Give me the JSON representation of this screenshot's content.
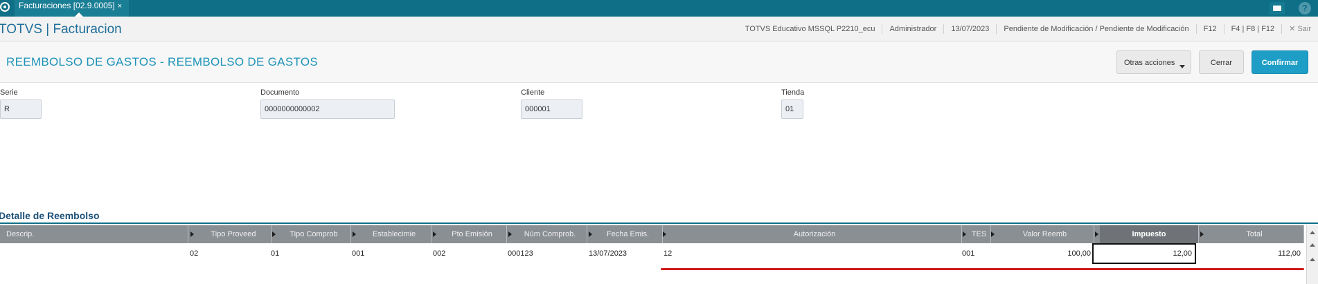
{
  "topbar": {
    "tab_label": "Facturaciones [02.9.0005]",
    "tab_close": "×",
    "help_glyph": "?"
  },
  "header": {
    "product": "TOTVS | Facturacion",
    "environment": "TOTVS Educativo MSSQL P2210_ecu",
    "user": "Administrador",
    "date": "13/07/2023",
    "status": "Pendiente de Modificación / Pendiente de Modificación",
    "key1": "F12",
    "key2": "F4 | F8 | F12",
    "exit": "✕  Sair"
  },
  "titlebar": {
    "title": "REEMBOLSO DE GASTOS - REEMBOLSO DE GASTOS",
    "otras_label": "Otras acciones",
    "cerrar_label": "Cerrar",
    "confirmar_label": "Confirmar"
  },
  "form": {
    "serie": {
      "label": "Serie",
      "value": "R"
    },
    "documento": {
      "label": "Documento",
      "value": "0000000000002"
    },
    "cliente": {
      "label": "Cliente",
      "value": "000001"
    },
    "tienda": {
      "label": "Tienda",
      "value": "01"
    }
  },
  "section": {
    "title": "Detalle de Reembolso"
  },
  "grid": {
    "headers": {
      "descrip": "Descrip.",
      "tipo_proveed": "Tipo Proveed",
      "tipo_comprob": "Tipo Comprob",
      "establecimie": "Establecimie",
      "pto_emision": "Pto Emisión",
      "num_comprob": "Núm Comprob.",
      "fecha_emis": "Fecha Emis.",
      "autorizacion": "Autorización",
      "tes": "TES",
      "valor_reemb": "Valor Reemb",
      "impuesto": "Impuesto",
      "total": "Total"
    },
    "row": {
      "descrip": "",
      "tipo_proveed": "02",
      "tipo_comprob": "01",
      "establecimie": "001",
      "pto_emision": "002",
      "num_comprob": "000123",
      "fecha_emis": "13/07/2023",
      "autorizacion": "12",
      "tes": "001",
      "valor_reemb": "100,00",
      "impuesto": "12,00",
      "total": "112,00"
    }
  },
  "colors": {
    "topbar": "#0e6f86",
    "accent": "#1e9ec6",
    "title": "#1c93b8",
    "grid_header": "#8a8f94",
    "highlight": "#d11a1a"
  },
  "icons": {
    "app": "totvs-logo-icon",
    "mail": "mail-icon",
    "help": "help-icon"
  }
}
